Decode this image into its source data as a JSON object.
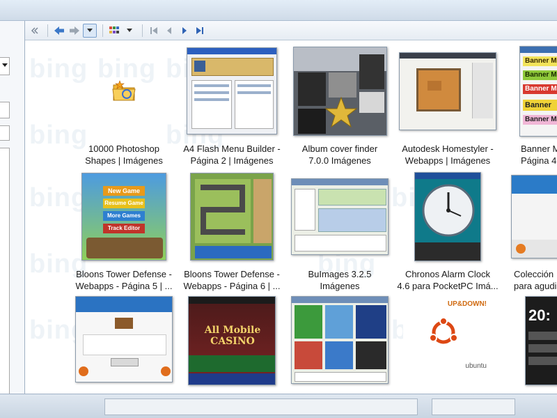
{
  "app": {
    "watermark": "bing"
  },
  "toolbar": {
    "collapse_icon": "double-chevron-left-icon",
    "back_icon": "back-arrow-icon",
    "forward_icon": "forward-arrow-icon",
    "dropdown_icon": "chevron-down-icon",
    "view_icon": "thumbnail-view-icon",
    "first_icon": "first-page-icon",
    "prev_icon": "previous-page-icon",
    "next_icon": "next-page-icon",
    "last_icon": "last-page-icon"
  },
  "results": [
    {
      "line1": "10000 Photoshop",
      "line2": "Shapes | Imágenes"
    },
    {
      "line1": "A4 Flash Menu Builder -",
      "line2": "Página 2 | Imágenes"
    },
    {
      "line1": "Album cover finder",
      "line2": "7.0.0 Imágenes"
    },
    {
      "line1": "Autodesk Homestyler -",
      "line2": "Webapps | Imágenes"
    },
    {
      "line1": "Banner M",
      "line2": "Página 4"
    },
    {
      "line1": "Bloons Tower Defense -",
      "line2": "Webapps - Página 5 | ..."
    },
    {
      "line1": "Bloons Tower Defense -",
      "line2": "Webapps - Página 6 | ..."
    },
    {
      "line1": "BuImages 3.2.5",
      "line2": "Imágenes"
    },
    {
      "line1": "Chronos Alarm Clock",
      "line2": "4.6 para PocketPC Imá..."
    },
    {
      "line1": "Colección",
      "line2": "para agudi"
    }
  ],
  "thumb_text": {
    "banner_1": "Banner M",
    "banner_2": "Banner M",
    "banner_3": "Banner M",
    "banner_4": "Banner",
    "banner_5": "Banner Mak",
    "bloons_menu_1": "New Game",
    "bloons_menu_2": "Resume Game",
    "bloons_menu_3": "More Games",
    "bloons_menu_4": "Track Editor",
    "casino_title": "All Mobile\nCASINO",
    "updown": "UP&DOWN!",
    "ubuntu": "ubuntu",
    "clock_digits": "20:"
  },
  "colors": {
    "accent": "#3c6fb0",
    "watermark": "#eef3f7"
  }
}
